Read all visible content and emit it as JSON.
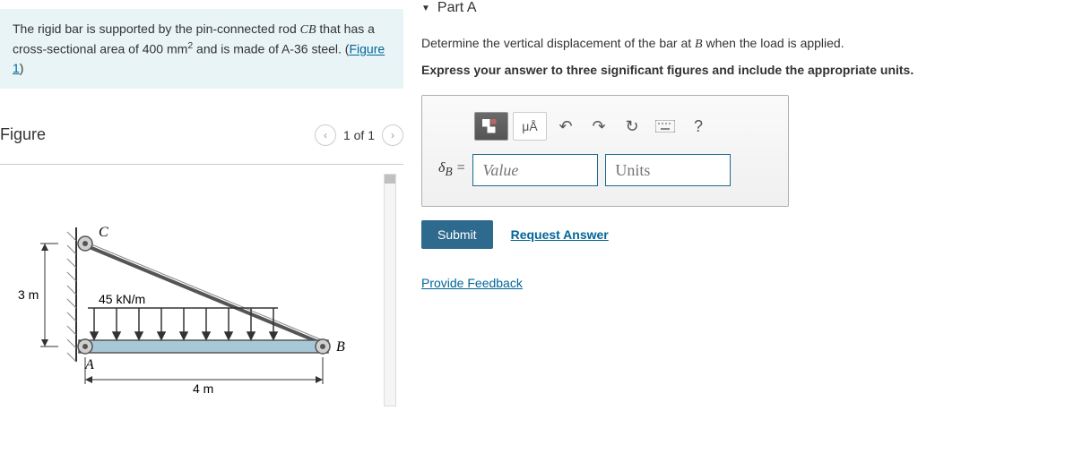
{
  "problem": {
    "text_before_link": "The rigid bar is supported by the pin-connected rod ",
    "rod_label": "CB",
    "text_after_rod": " that has a cross-sectional area of 400 ",
    "unit": "mm",
    "exponent": "2",
    "text_after_unit": " and is made of A-36 steel. (",
    "figure_link": "Figure 1",
    "text_after_link": ")"
  },
  "figure": {
    "title": "Figure",
    "nav_text": "1 of 1",
    "labels": {
      "C": "C",
      "A": "A",
      "B": "B",
      "height": "3 m",
      "width": "4 m",
      "load": "45 kN/m"
    }
  },
  "part": {
    "header": "Part A",
    "question": "Determine the vertical displacement of the bar at ",
    "point": "B",
    "question_end": " when the load is applied.",
    "instruction": "Express your answer to three significant figures and include the appropriate units.",
    "toolbar": {
      "units_btn": "μÅ",
      "help": "?"
    },
    "delta": "δ",
    "subscript": "B",
    "equals": " = ",
    "value_placeholder": "Value",
    "units_placeholder": "Units",
    "submit": "Submit",
    "request": "Request Answer"
  },
  "feedback": "Provide Feedback"
}
